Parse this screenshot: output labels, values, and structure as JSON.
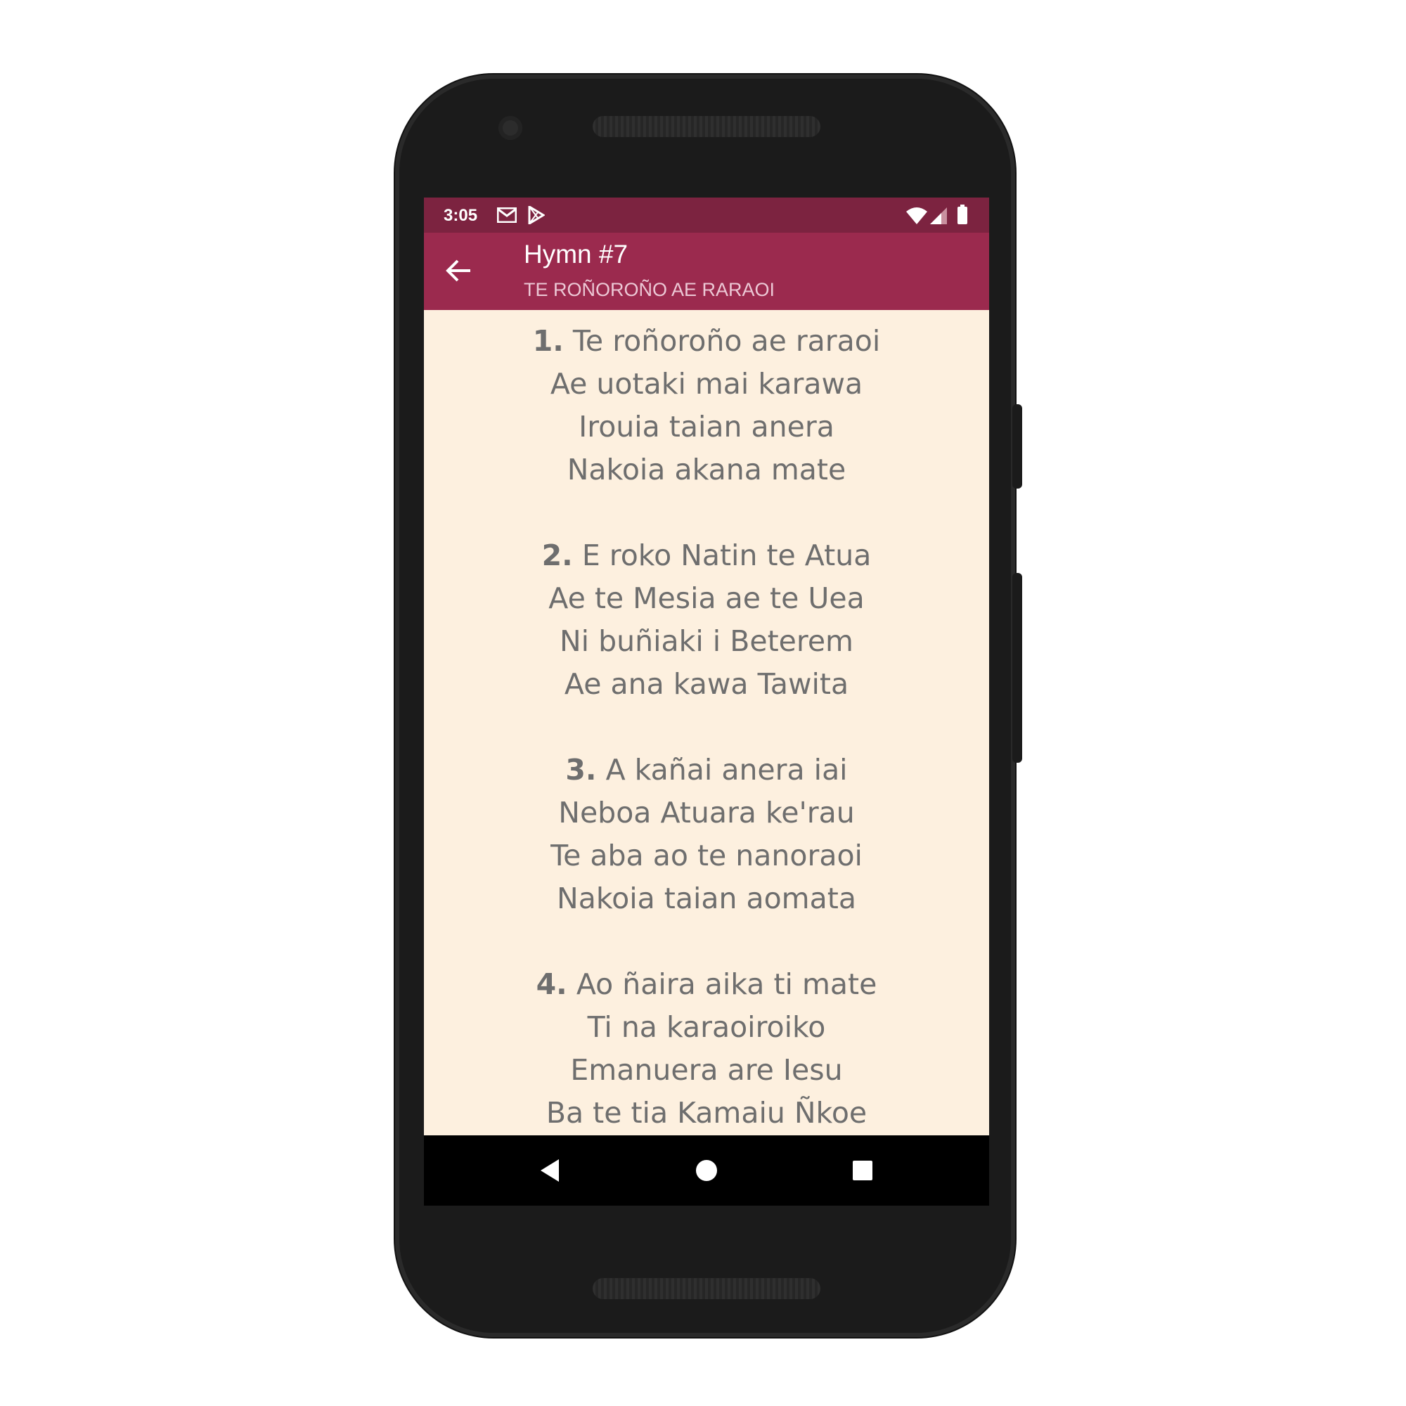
{
  "status_bar": {
    "time": "3:05",
    "icons": [
      "gmail-icon",
      "play-store-icon",
      "wifi-icon",
      "signal-icon",
      "battery-icon"
    ]
  },
  "app_bar": {
    "back_icon": "arrow-back-icon",
    "title": "Hymn #7",
    "subtitle": "TE ROÑOROÑO AE RARAOI",
    "color": "#9b2a4e",
    "status_color": "#7c2340"
  },
  "content": {
    "background": "#fdf0df",
    "text_color": "#6e6e6e",
    "verses": [
      {
        "number": "1.",
        "lines": [
          "Te roñoroño ae raraoi",
          "Ae uotaki mai karawa",
          "Irouia taian anera",
          "Nakoia akana mate"
        ]
      },
      {
        "number": "2.",
        "lines": [
          "E roko Natin te Atua",
          "Ae te Mesia ae te Uea",
          "Ni buñiaki i Beterem",
          "Ae ana kawa Tawita"
        ]
      },
      {
        "number": "3.",
        "lines": [
          "A kañai anera iai",
          "Neboa Atuara ke'rau",
          "Te aba ao te nanoraoi",
          "Nakoia taian aomata"
        ]
      },
      {
        "number": "4.",
        "lines": [
          "Ao ñaira aika ti mate",
          "Ti na karaoiroiko",
          "Emanuera are Iesu",
          "Ba te tia Kamaiu Ñkoe"
        ]
      }
    ]
  },
  "nav_bar": {
    "buttons": [
      "back-triangle-icon",
      "home-circle-icon",
      "recents-square-icon"
    ]
  }
}
